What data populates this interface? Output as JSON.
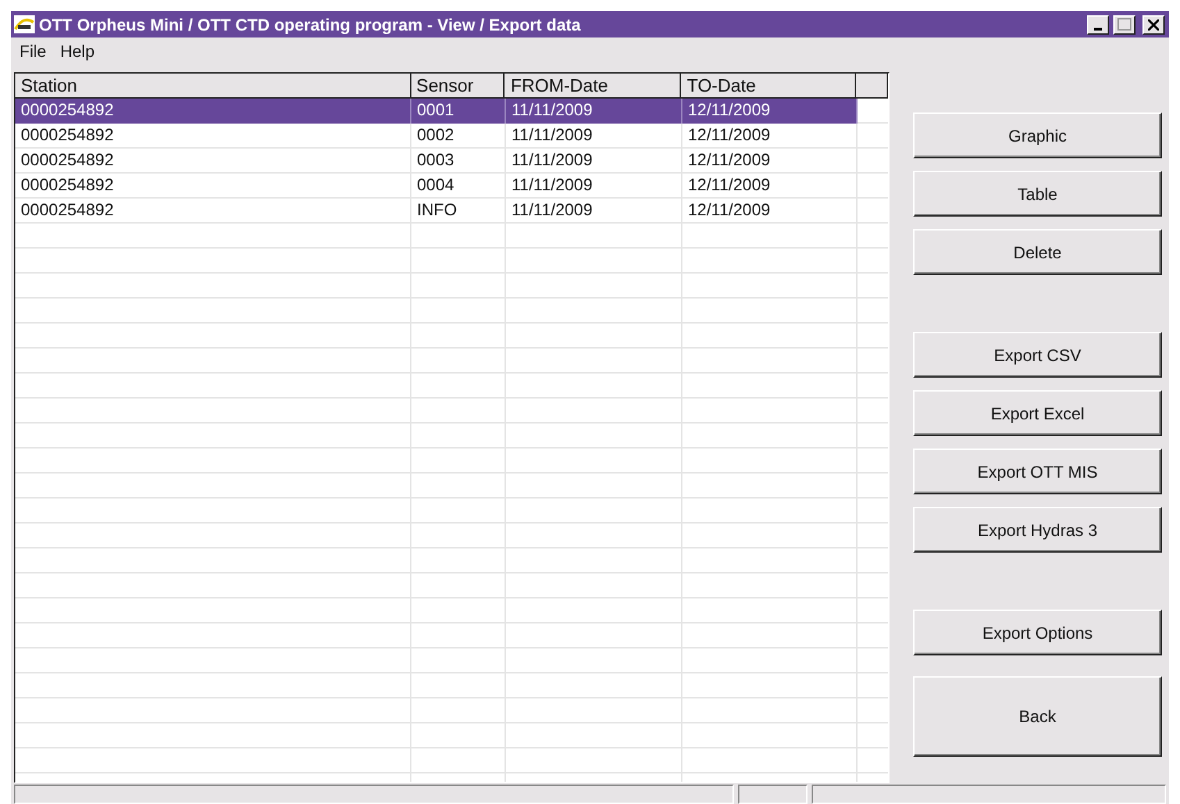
{
  "window": {
    "title": "OTT Orpheus Mini / OTT CTD operating program  -  View / Export data"
  },
  "menu": [
    "File",
    "Help"
  ],
  "table": {
    "columns": [
      "Station",
      "Sensor",
      "FROM-Date",
      "TO-Date"
    ],
    "rows": [
      {
        "cells": [
          "0000254892",
          "0001",
          "11/11/2009",
          "12/11/2009"
        ],
        "selected": true
      },
      {
        "cells": [
          "0000254892",
          "0002",
          "11/11/2009",
          "12/11/2009"
        ],
        "selected": false
      },
      {
        "cells": [
          "0000254892",
          "0003",
          "11/11/2009",
          "12/11/2009"
        ],
        "selected": false
      },
      {
        "cells": [
          "0000254892",
          "0004",
          "11/11/2009",
          "12/11/2009"
        ],
        "selected": false
      },
      {
        "cells": [
          "0000254892",
          "INFO",
          "11/11/2009",
          "12/11/2009"
        ],
        "selected": false
      }
    ]
  },
  "button_groups": [
    [
      {
        "label": "Graphic",
        "kind": "normal"
      },
      {
        "label": "Table",
        "kind": "normal"
      },
      {
        "label": "Delete",
        "kind": "normal"
      }
    ],
    [
      {
        "label": "Export CSV",
        "kind": "normal"
      },
      {
        "label": "Export Excel",
        "kind": "normal"
      },
      {
        "label": "Export OTT MIS",
        "kind": "normal"
      },
      {
        "label": "Export Hydras 3",
        "kind": "normal"
      }
    ],
    [
      {
        "label": "Export Options",
        "kind": "normal"
      },
      {
        "label": "Back",
        "kind": "large"
      }
    ]
  ]
}
